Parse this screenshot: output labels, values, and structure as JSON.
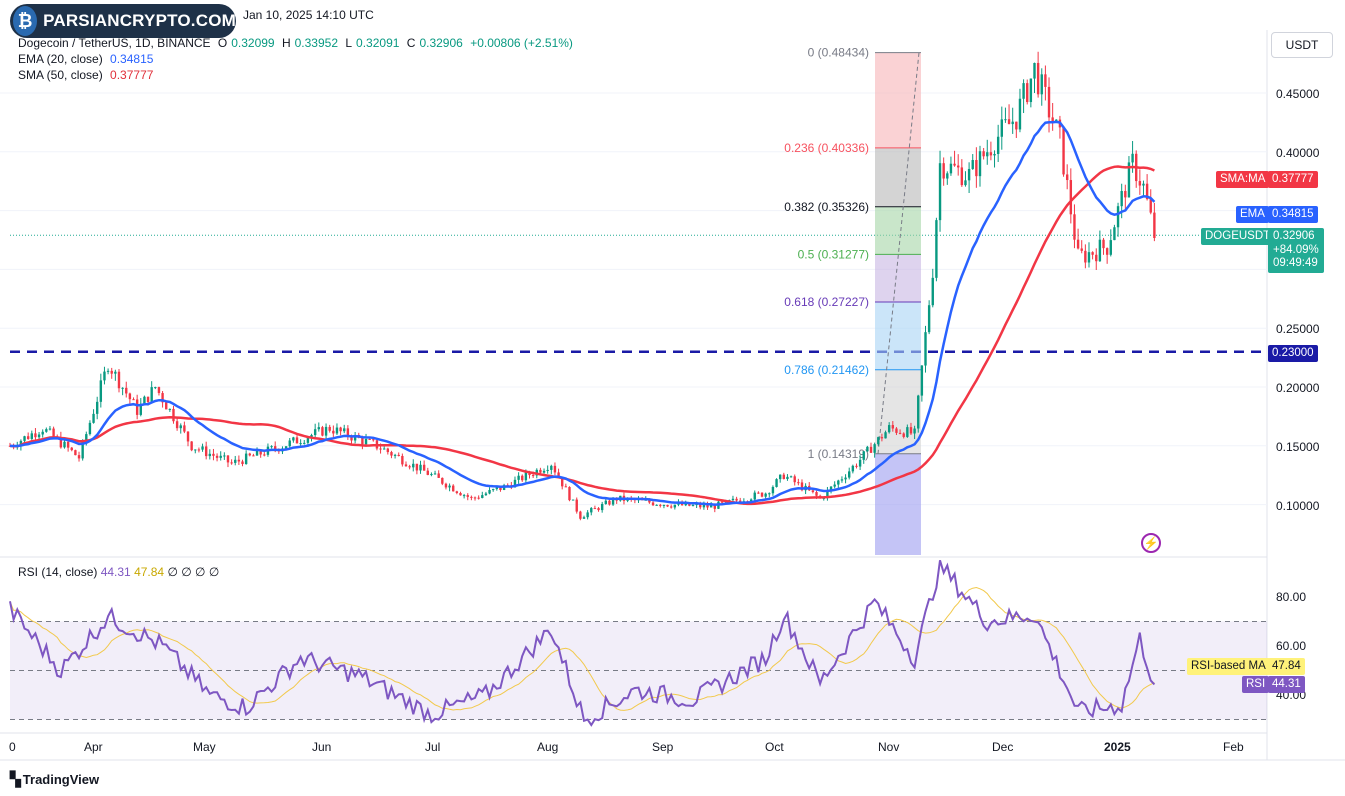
{
  "header": {
    "logo_text": "PARSIANCRYPTO.COM",
    "date": "Jan 10, 2025 14:10 UTC"
  },
  "legend": {
    "symbol": "Dogecoin / TetherUS, 1D, BINANCE",
    "open_label": "O",
    "open": "0.32099",
    "high_label": "H",
    "high": "0.33952",
    "low_label": "L",
    "low": "0.32091",
    "close_label": "C",
    "close": "0.32906",
    "change": "+0.00806 (+2.51%)",
    "ema_label": "EMA (20, close)",
    "ema_value": "0.34815",
    "sma_label": "SMA (50, close)",
    "sma_value": "0.37777"
  },
  "rsi_legend": {
    "label": "RSI (14, close)",
    "rsi": "44.31",
    "ma": "47.84",
    "extra": "∅ ∅ ∅ ∅"
  },
  "unit_button": "USDT",
  "price_axis": [
    "0.45000",
    "0.40000",
    "0.25000",
    "0.20000",
    "0.15000",
    "0.10000"
  ],
  "rsi_axis": [
    "80.00",
    "60.00",
    "40.00"
  ],
  "time_axis": [
    "0",
    "Apr",
    "May",
    "Jun",
    "Jul",
    "Aug",
    "Sep",
    "Oct",
    "Nov",
    "Dec",
    "2025",
    "Feb"
  ],
  "tags": {
    "sma": {
      "label": "SMA:MA",
      "value": "0.37777",
      "color": "#f23645"
    },
    "ema": {
      "label": "EMA",
      "value": "0.34815",
      "color": "#2962ff"
    },
    "price": {
      "label": "DOGEUSDT",
      "value": "0.32906",
      "pct": "+84.09%",
      "countdown": "09:49:49",
      "color": "#22ab94"
    },
    "support": {
      "value": "0.23000",
      "color": "#1a1aa6"
    },
    "rsi_ma": {
      "label": "RSI-based MA",
      "value": "47.84",
      "color": "#fff27a"
    },
    "rsi": {
      "label": "RSI",
      "value": "44.31",
      "color": "#7e57c2"
    }
  },
  "fibonacci": [
    {
      "ratio": "0",
      "price": "0.48434",
      "color": "#787b86"
    },
    {
      "ratio": "0.236",
      "price": "0.40336",
      "color": "#f7525f"
    },
    {
      "ratio": "0.382",
      "price": "0.35326",
      "color": "#131722"
    },
    {
      "ratio": "0.5",
      "price": "0.31277",
      "color": "#4caf50"
    },
    {
      "ratio": "0.618",
      "price": "0.27227",
      "color": "#673ab7"
    },
    {
      "ratio": "0.786",
      "price": "0.21462",
      "color": "#2196f3"
    },
    {
      "ratio": "1",
      "price": "0.14319",
      "color": "#787b86"
    }
  ],
  "footer": {
    "brand": "TradingView"
  },
  "colors": {
    "up": "#089981",
    "down": "#f23645",
    "ema": "#2962ff",
    "sma": "#f23645",
    "rsi": "#7e57c2",
    "rsi_ma": "#f2c94c"
  },
  "chart_data": {
    "type": "candlestick",
    "title": "Dogecoin / TetherUS, 1D, BINANCE",
    "x_range": [
      "2024-03-01",
      "2025-02-10"
    ],
    "ylim": [
      0.06,
      0.5
    ],
    "support_level": 0.23,
    "closes": [
      {
        "date": "2024-03-01",
        "close": 0.15
      },
      {
        "date": "2024-03-10",
        "close": 0.165
      },
      {
        "date": "2024-03-20",
        "close": 0.14
      },
      {
        "date": "2024-03-28",
        "close": 0.22
      },
      {
        "date": "2024-04-05",
        "close": 0.18
      },
      {
        "date": "2024-04-10",
        "close": 0.2
      },
      {
        "date": "2024-04-20",
        "close": 0.15
      },
      {
        "date": "2024-05-01",
        "close": 0.135
      },
      {
        "date": "2024-05-15",
        "close": 0.15
      },
      {
        "date": "2024-05-28",
        "close": 0.165
      },
      {
        "date": "2024-06-10",
        "close": 0.15
      },
      {
        "date": "2024-06-25",
        "close": 0.125
      },
      {
        "date": "2024-07-06",
        "close": 0.105
      },
      {
        "date": "2024-07-15",
        "close": 0.115
      },
      {
        "date": "2024-07-28",
        "close": 0.135
      },
      {
        "date": "2024-08-05",
        "close": 0.09
      },
      {
        "date": "2024-08-15",
        "close": 0.105
      },
      {
        "date": "2024-08-30",
        "close": 0.1
      },
      {
        "date": "2024-09-10",
        "close": 0.098
      },
      {
        "date": "2024-09-25",
        "close": 0.11
      },
      {
        "date": "2024-09-30",
        "close": 0.125
      },
      {
        "date": "2024-10-10",
        "close": 0.105
      },
      {
        "date": "2024-10-20",
        "close": 0.135
      },
      {
        "date": "2024-10-29",
        "close": 0.165
      },
      {
        "date": "2024-11-05",
        "close": 0.16
      },
      {
        "date": "2024-11-10",
        "close": 0.3
      },
      {
        "date": "2024-11-12",
        "close": 0.39
      },
      {
        "date": "2024-11-20",
        "close": 0.38
      },
      {
        "date": "2024-11-27",
        "close": 0.41
      },
      {
        "date": "2024-12-03",
        "close": 0.43
      },
      {
        "date": "2024-12-08",
        "close": 0.47
      },
      {
        "date": "2024-12-15",
        "close": 0.41
      },
      {
        "date": "2024-12-20",
        "close": 0.31
      },
      {
        "date": "2024-12-28",
        "close": 0.32
      },
      {
        "date": "2025-01-04",
        "close": 0.39
      },
      {
        "date": "2025-01-07",
        "close": 0.37
      },
      {
        "date": "2025-01-10",
        "close": 0.329
      }
    ],
    "ema20": {
      "name": "EMA (20, close)",
      "last": 0.34815
    },
    "sma50": {
      "name": "SMA (50, close)",
      "last": 0.37777
    },
    "rsi": {
      "name": "RSI (14, close)",
      "ylim": [
        25,
        95
      ],
      "bands": [
        30,
        50,
        70
      ],
      "last": 44.31,
      "ma_last": 47.84,
      "values": [
        {
          "date": "2024-03-01",
          "value": 75
        },
        {
          "date": "2024-03-15",
          "value": 50
        },
        {
          "date": "2024-03-28",
          "value": 72
        },
        {
          "date": "2024-04-12",
          "value": 60
        },
        {
          "date": "2024-04-25",
          "value": 40
        },
        {
          "date": "2024-05-05",
          "value": 35
        },
        {
          "date": "2024-05-20",
          "value": 55
        },
        {
          "date": "2024-06-05",
          "value": 48
        },
        {
          "date": "2024-06-25",
          "value": 32
        },
        {
          "date": "2024-07-10",
          "value": 40
        },
        {
          "date": "2024-07-20",
          "value": 55
        },
        {
          "date": "2024-07-28",
          "value": 67
        },
        {
          "date": "2024-08-06",
          "value": 30
        },
        {
          "date": "2024-08-20",
          "value": 42
        },
        {
          "date": "2024-09-05",
          "value": 38
        },
        {
          "date": "2024-09-25",
          "value": 55
        },
        {
          "date": "2024-09-30",
          "value": 73
        },
        {
          "date": "2024-10-10",
          "value": 45
        },
        {
          "date": "2024-10-25",
          "value": 78
        },
        {
          "date": "2024-11-05",
          "value": 55
        },
        {
          "date": "2024-11-12",
          "value": 93
        },
        {
          "date": "2024-11-25",
          "value": 70
        },
        {
          "date": "2024-12-08",
          "value": 73
        },
        {
          "date": "2024-12-15",
          "value": 50
        },
        {
          "date": "2024-12-20",
          "value": 33
        },
        {
          "date": "2025-01-01",
          "value": 36
        },
        {
          "date": "2025-01-06",
          "value": 63
        },
        {
          "date": "2025-01-10",
          "value": 44.31
        }
      ]
    }
  }
}
